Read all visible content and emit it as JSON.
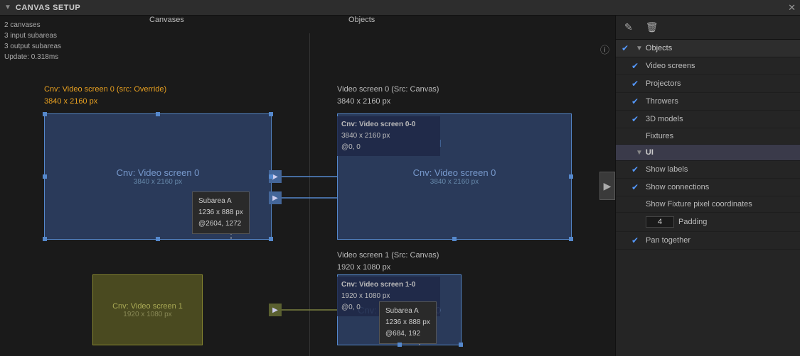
{
  "titlebar": {
    "icon": "▼",
    "title": "CANVAS SETUP",
    "close_label": "✕"
  },
  "stats": {
    "canvases": "2 canvases",
    "input_subareas": "3 input subareas",
    "output_subareas": "3 output subareas",
    "update": "Update: 0.318ms"
  },
  "columns": {
    "canvases": "Canvases",
    "objects": "Objects"
  },
  "canvas0_left": {
    "label_line1": "Cnv: Video screen 0 (src: Override)",
    "label_line2": "3840 x 2160 px",
    "center_text": "Cnv: Video screen 0",
    "center_sub": "3840 x 2160 px"
  },
  "canvas1_left": {
    "center_text": "Cnv: Video screen 1",
    "center_sub": "1920 x 1080 px"
  },
  "subarea_a_left": {
    "title": "Subarea A",
    "size": "1236 x 888 px",
    "position": "@2604, 1272"
  },
  "subarea_a_right": {
    "title": "Subarea A",
    "size": "1236 x 888 px",
    "position": "@684, 192"
  },
  "obj_video0": {
    "label_line1": "Video screen 0 (Src: Canvas)",
    "label_line2": "3840 x 2160 px",
    "center_text": "Cnv: Video screen 0",
    "center_sub": "3840 x 2160 px",
    "inner_line1": "Cnv: Video screen 0-0",
    "inner_line2": "3840 x 2160 px",
    "inner_line3": "@0, 0"
  },
  "obj_video1": {
    "label_line1": "Video screen 1 (Src: Canvas)",
    "label_line2": "1920 x 1080 px",
    "center_text": "Cnv: Video screen 0",
    "center_sub": "3840 x 2160 px",
    "inner_line1": "Cnv: Video screen 1-0",
    "inner_line2": "1920 x 1080 px",
    "inner_line3": "@0, 0"
  },
  "right_panel": {
    "toolbar": {
      "edit_icon": "✎",
      "delete_icon": "🗑"
    },
    "sections": [
      {
        "id": "objects",
        "label": "Objects",
        "expanded": true,
        "chevron": "▼",
        "checked": true
      }
    ],
    "items": [
      {
        "id": "video-screens",
        "label": "Video screens",
        "checked": true
      },
      {
        "id": "projectors",
        "label": "Projectors",
        "checked": true
      },
      {
        "id": "throwers",
        "label": "Throwers",
        "checked": true
      },
      {
        "id": "3d-models",
        "label": "3D models",
        "checked": true
      },
      {
        "id": "fixtures",
        "label": "Fixtures",
        "checked": false
      }
    ],
    "ui_section": {
      "label": "UI",
      "chevron": "▼",
      "expanded": true
    },
    "ui_items": [
      {
        "id": "show-labels",
        "label": "Show labels",
        "checked": true
      },
      {
        "id": "show-connections",
        "label": "Show connections",
        "checked": true
      },
      {
        "id": "show-fixture-coords",
        "label": "Show Fixture pixel coordinates",
        "checked": false
      },
      {
        "id": "padding",
        "label": "Padding",
        "value": "4"
      },
      {
        "id": "pan-together",
        "label": "Pan together",
        "checked": true
      }
    ]
  }
}
